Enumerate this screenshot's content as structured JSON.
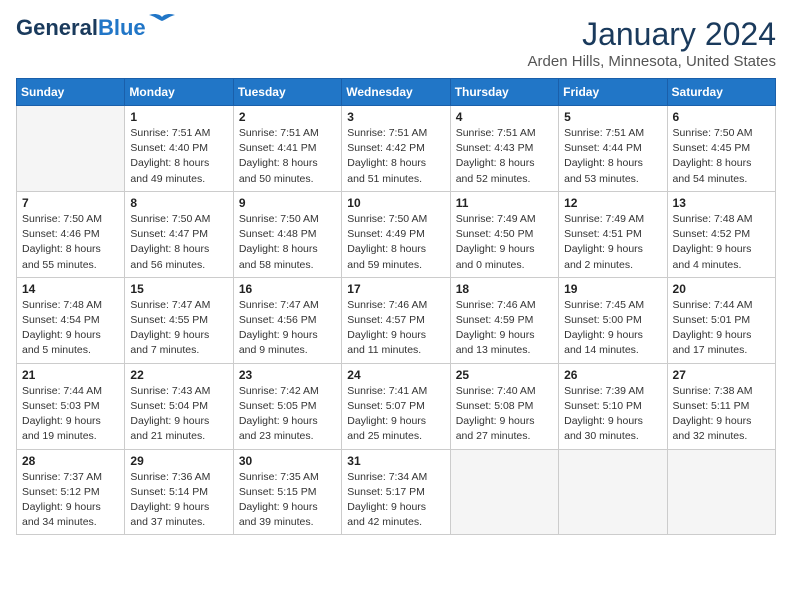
{
  "header": {
    "logo_line1": "General",
    "logo_line2": "Blue",
    "month_title": "January 2024",
    "location": "Arden Hills, Minnesota, United States"
  },
  "days_of_week": [
    "Sunday",
    "Monday",
    "Tuesday",
    "Wednesday",
    "Thursday",
    "Friday",
    "Saturday"
  ],
  "weeks": [
    [
      {
        "day": "",
        "info": ""
      },
      {
        "day": "1",
        "info": "Sunrise: 7:51 AM\nSunset: 4:40 PM\nDaylight: 8 hours\nand 49 minutes."
      },
      {
        "day": "2",
        "info": "Sunrise: 7:51 AM\nSunset: 4:41 PM\nDaylight: 8 hours\nand 50 minutes."
      },
      {
        "day": "3",
        "info": "Sunrise: 7:51 AM\nSunset: 4:42 PM\nDaylight: 8 hours\nand 51 minutes."
      },
      {
        "day": "4",
        "info": "Sunrise: 7:51 AM\nSunset: 4:43 PM\nDaylight: 8 hours\nand 52 minutes."
      },
      {
        "day": "5",
        "info": "Sunrise: 7:51 AM\nSunset: 4:44 PM\nDaylight: 8 hours\nand 53 minutes."
      },
      {
        "day": "6",
        "info": "Sunrise: 7:50 AM\nSunset: 4:45 PM\nDaylight: 8 hours\nand 54 minutes."
      }
    ],
    [
      {
        "day": "7",
        "info": "Sunrise: 7:50 AM\nSunset: 4:46 PM\nDaylight: 8 hours\nand 55 minutes."
      },
      {
        "day": "8",
        "info": "Sunrise: 7:50 AM\nSunset: 4:47 PM\nDaylight: 8 hours\nand 56 minutes."
      },
      {
        "day": "9",
        "info": "Sunrise: 7:50 AM\nSunset: 4:48 PM\nDaylight: 8 hours\nand 58 minutes."
      },
      {
        "day": "10",
        "info": "Sunrise: 7:50 AM\nSunset: 4:49 PM\nDaylight: 8 hours\nand 59 minutes."
      },
      {
        "day": "11",
        "info": "Sunrise: 7:49 AM\nSunset: 4:50 PM\nDaylight: 9 hours\nand 0 minutes."
      },
      {
        "day": "12",
        "info": "Sunrise: 7:49 AM\nSunset: 4:51 PM\nDaylight: 9 hours\nand 2 minutes."
      },
      {
        "day": "13",
        "info": "Sunrise: 7:48 AM\nSunset: 4:52 PM\nDaylight: 9 hours\nand 4 minutes."
      }
    ],
    [
      {
        "day": "14",
        "info": "Sunrise: 7:48 AM\nSunset: 4:54 PM\nDaylight: 9 hours\nand 5 minutes."
      },
      {
        "day": "15",
        "info": "Sunrise: 7:47 AM\nSunset: 4:55 PM\nDaylight: 9 hours\nand 7 minutes."
      },
      {
        "day": "16",
        "info": "Sunrise: 7:47 AM\nSunset: 4:56 PM\nDaylight: 9 hours\nand 9 minutes."
      },
      {
        "day": "17",
        "info": "Sunrise: 7:46 AM\nSunset: 4:57 PM\nDaylight: 9 hours\nand 11 minutes."
      },
      {
        "day": "18",
        "info": "Sunrise: 7:46 AM\nSunset: 4:59 PM\nDaylight: 9 hours\nand 13 minutes."
      },
      {
        "day": "19",
        "info": "Sunrise: 7:45 AM\nSunset: 5:00 PM\nDaylight: 9 hours\nand 14 minutes."
      },
      {
        "day": "20",
        "info": "Sunrise: 7:44 AM\nSunset: 5:01 PM\nDaylight: 9 hours\nand 17 minutes."
      }
    ],
    [
      {
        "day": "21",
        "info": "Sunrise: 7:44 AM\nSunset: 5:03 PM\nDaylight: 9 hours\nand 19 minutes."
      },
      {
        "day": "22",
        "info": "Sunrise: 7:43 AM\nSunset: 5:04 PM\nDaylight: 9 hours\nand 21 minutes."
      },
      {
        "day": "23",
        "info": "Sunrise: 7:42 AM\nSunset: 5:05 PM\nDaylight: 9 hours\nand 23 minutes."
      },
      {
        "day": "24",
        "info": "Sunrise: 7:41 AM\nSunset: 5:07 PM\nDaylight: 9 hours\nand 25 minutes."
      },
      {
        "day": "25",
        "info": "Sunrise: 7:40 AM\nSunset: 5:08 PM\nDaylight: 9 hours\nand 27 minutes."
      },
      {
        "day": "26",
        "info": "Sunrise: 7:39 AM\nSunset: 5:10 PM\nDaylight: 9 hours\nand 30 minutes."
      },
      {
        "day": "27",
        "info": "Sunrise: 7:38 AM\nSunset: 5:11 PM\nDaylight: 9 hours\nand 32 minutes."
      }
    ],
    [
      {
        "day": "28",
        "info": "Sunrise: 7:37 AM\nSunset: 5:12 PM\nDaylight: 9 hours\nand 34 minutes."
      },
      {
        "day": "29",
        "info": "Sunrise: 7:36 AM\nSunset: 5:14 PM\nDaylight: 9 hours\nand 37 minutes."
      },
      {
        "day": "30",
        "info": "Sunrise: 7:35 AM\nSunset: 5:15 PM\nDaylight: 9 hours\nand 39 minutes."
      },
      {
        "day": "31",
        "info": "Sunrise: 7:34 AM\nSunset: 5:17 PM\nDaylight: 9 hours\nand 42 minutes."
      },
      {
        "day": "",
        "info": ""
      },
      {
        "day": "",
        "info": ""
      },
      {
        "day": "",
        "info": ""
      }
    ]
  ]
}
